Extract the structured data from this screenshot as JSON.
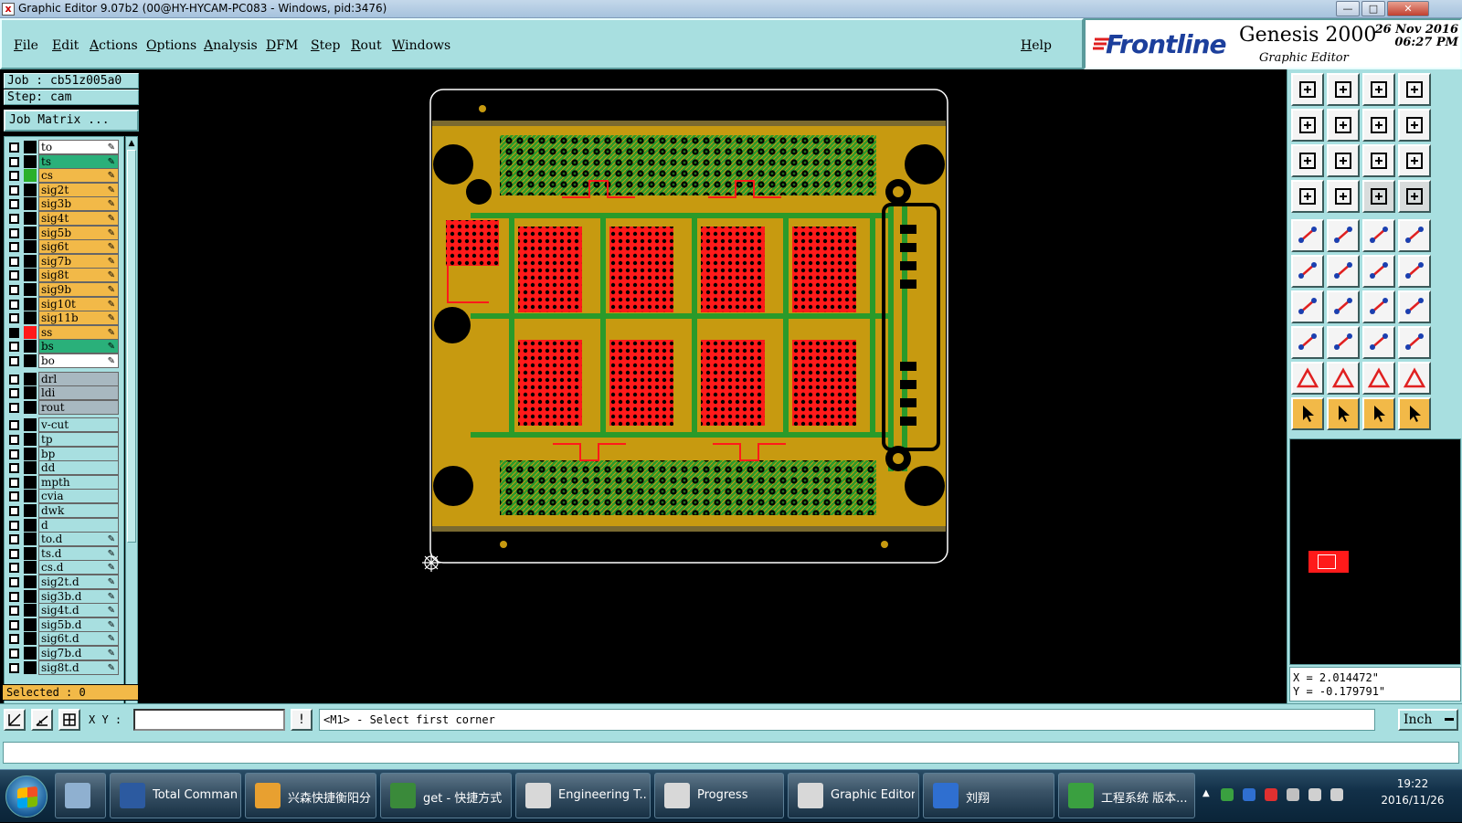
{
  "window": {
    "title": "Graphic Editor 9.07b2 (00@HY-HYCAM-PC083 - Windows, pid:3476)",
    "minimize": "—",
    "maximize": "□",
    "close": "✕"
  },
  "menu": {
    "items": [
      "File",
      "Edit",
      "Actions",
      "Options",
      "Analysis",
      "DFM",
      "Step",
      "Rout",
      "Windows"
    ],
    "help": "Help"
  },
  "brand": {
    "logo": "Frontline",
    "product": "Genesis 2000",
    "subtitle": "Graphic Editor",
    "date": "26 Nov 2016",
    "time": "06:27 PM"
  },
  "job": {
    "job_line": "Job : cb51z005a0",
    "step_line": "Step: cam",
    "matrix_button": "Job Matrix ...",
    "selected": "Selected : 0"
  },
  "layers": [
    {
      "name": "to",
      "color": "#ffffff",
      "swatch": "#000000",
      "edit": true
    },
    {
      "name": "ts",
      "color": "#2ab07a",
      "swatch": "#000000",
      "edit": true
    },
    {
      "name": "cs",
      "color": "#f2b948",
      "swatch": "#2ab02a",
      "edit": true
    },
    {
      "name": "sig2t",
      "color": "#f2b948",
      "swatch": "#000000",
      "edit": true
    },
    {
      "name": "sig3b",
      "color": "#f2b948",
      "swatch": "#000000",
      "edit": true
    },
    {
      "name": "sig4t",
      "color": "#f2b948",
      "swatch": "#000000",
      "edit": true
    },
    {
      "name": "sig5b",
      "color": "#f2b948",
      "swatch": "#000000",
      "edit": true
    },
    {
      "name": "sig6t",
      "color": "#f2b948",
      "swatch": "#000000",
      "edit": true
    },
    {
      "name": "sig7b",
      "color": "#f2b948",
      "swatch": "#000000",
      "edit": true
    },
    {
      "name": "sig8t",
      "color": "#f2b948",
      "swatch": "#000000",
      "edit": true
    },
    {
      "name": "sig9b",
      "color": "#f2b948",
      "swatch": "#000000",
      "edit": true
    },
    {
      "name": "sig10t",
      "color": "#f2b948",
      "swatch": "#000000",
      "edit": true
    },
    {
      "name": "sig11b",
      "color": "#f2b948",
      "swatch": "#000000",
      "edit": true
    },
    {
      "name": "ss",
      "color": "#f2b948",
      "swatch": "#ff1a1a",
      "edit": true,
      "checked": true
    },
    {
      "name": "bs",
      "color": "#2ab07a",
      "swatch": "#000000",
      "edit": true
    },
    {
      "name": "bo",
      "color": "#ffffff",
      "swatch": "#000000",
      "edit": true
    },
    {
      "name": "drl",
      "color": "#a8b8c0",
      "swatch": "#000000",
      "edit": false,
      "gap": true
    },
    {
      "name": "ldi",
      "color": "#a8b8c0",
      "swatch": "#000000",
      "edit": false
    },
    {
      "name": "rout",
      "color": "#a8b8c0",
      "swatch": "#000000",
      "edit": false
    },
    {
      "name": "v-cut",
      "color": "#a8dfe0",
      "swatch": "#000000",
      "edit": false,
      "gap": true
    },
    {
      "name": "tp",
      "color": "#a8dfe0",
      "swatch": "#000000",
      "edit": false
    },
    {
      "name": "bp",
      "color": "#a8dfe0",
      "swatch": "#000000",
      "edit": false
    },
    {
      "name": "dd",
      "color": "#a8dfe0",
      "swatch": "#000000",
      "edit": false
    },
    {
      "name": "mpth",
      "color": "#a8dfe0",
      "swatch": "#000000",
      "edit": false
    },
    {
      "name": "cvia",
      "color": "#a8dfe0",
      "swatch": "#000000",
      "edit": false
    },
    {
      "name": "dwk",
      "color": "#a8dfe0",
      "swatch": "#000000",
      "edit": false
    },
    {
      "name": "d",
      "color": "#a8dfe0",
      "swatch": "#000000",
      "edit": false
    },
    {
      "name": "to.d",
      "color": "#a8dfe0",
      "swatch": "#000000",
      "edit": true
    },
    {
      "name": "ts.d",
      "color": "#a8dfe0",
      "swatch": "#000000",
      "edit": true
    },
    {
      "name": "cs.d",
      "color": "#a8dfe0",
      "swatch": "#000000",
      "edit": true
    },
    {
      "name": "sig2t.d",
      "color": "#a8dfe0",
      "swatch": "#000000",
      "edit": true
    },
    {
      "name": "sig3b.d",
      "color": "#a8dfe0",
      "swatch": "#000000",
      "edit": true
    },
    {
      "name": "sig4t.d",
      "color": "#a8dfe0",
      "swatch": "#000000",
      "edit": true
    },
    {
      "name": "sig5b.d",
      "color": "#a8dfe0",
      "swatch": "#000000",
      "edit": true
    },
    {
      "name": "sig6t.d",
      "color": "#a8dfe0",
      "swatch": "#000000",
      "edit": true
    },
    {
      "name": "sig7b.d",
      "color": "#a8dfe0",
      "swatch": "#000000",
      "edit": true
    },
    {
      "name": "sig8t.d",
      "color": "#a8dfe0",
      "swatch": "#000000",
      "edit": true
    }
  ],
  "coords": {
    "x": "X = 2.014472\"",
    "y": "Y = -0.179791\""
  },
  "status": {
    "xy_label": "X Y :",
    "xy_value": "",
    "info_button": "!",
    "message": "<M1> - Select first corner",
    "units": "Inch"
  },
  "taskbar": {
    "items": [
      {
        "label": "Total Comman...",
        "color": "#2c5aa0"
      },
      {
        "label": "兴森快捷衡阳分...",
        "color": "#e8a030"
      },
      {
        "label": "get - 快捷方式",
        "color": "#3a8a3a"
      },
      {
        "label": "Engineering T...",
        "color": "#d8d8d8"
      },
      {
        "label": "Progress",
        "color": "#d8d8d8"
      },
      {
        "label": "Graphic Editor...",
        "color": "#d8d8d8"
      },
      {
        "label": "刘翔",
        "color": "#2f6fd0"
      },
      {
        "label": "工程系统  版本...",
        "color": "#3aa040"
      }
    ],
    "time": "19:22",
    "date": "2016/11/26"
  }
}
